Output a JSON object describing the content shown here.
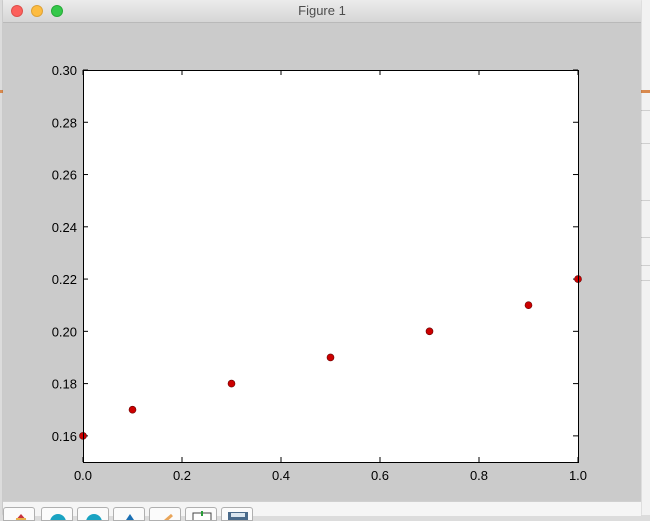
{
  "window": {
    "title": "Figure 1"
  },
  "toolbar": {
    "buttons": [
      {
        "icon": "home-icon"
      },
      {
        "icon": "back-icon"
      },
      {
        "icon": "forward-icon"
      },
      {
        "icon": "pan-icon"
      },
      {
        "icon": "zoom-icon"
      },
      {
        "icon": "subplots-icon"
      },
      {
        "icon": "save-icon"
      }
    ]
  },
  "chart_data": {
    "type": "scatter",
    "title": "",
    "xlabel": "",
    "ylabel": "",
    "xlim": [
      0.0,
      1.0
    ],
    "ylim": [
      0.15,
      0.3
    ],
    "x_ticks": [
      "0.0",
      "0.2",
      "0.4",
      "0.6",
      "0.8",
      "1.0"
    ],
    "y_ticks": [
      "0.16",
      "0.18",
      "0.20",
      "0.22",
      "0.24",
      "0.26",
      "0.28",
      "0.30"
    ],
    "grid": false,
    "marker_color": "#cc0000",
    "series": [
      {
        "x": [
          0.0,
          0.1,
          0.3,
          0.5,
          0.7,
          0.9,
          1.0
        ],
        "y": [
          0.16,
          0.17,
          0.18,
          0.19,
          0.2,
          0.21,
          0.22
        ]
      }
    ]
  }
}
